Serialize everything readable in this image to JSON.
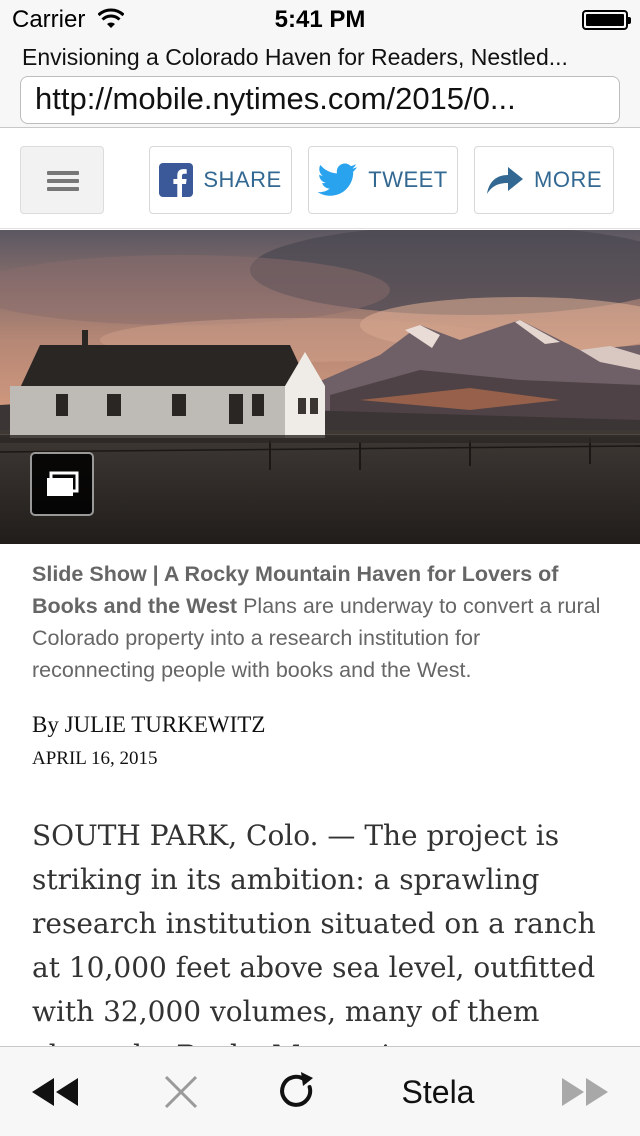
{
  "status_bar": {
    "carrier": "Carrier",
    "time": "5:41 PM"
  },
  "browser": {
    "page_title": "Envisioning a Colorado Haven for Readers, Nestled...",
    "url": "http://mobile.nytimes.com/2015/0..."
  },
  "share_toolbar": {
    "menu_icon": "hamburger-icon",
    "share_label": "SHARE",
    "tweet_label": "TWEET",
    "more_label": "MORE",
    "accent_color": "#326891"
  },
  "caption": {
    "title": "Slide Show | A Rocky Mountain Haven for Lovers of Books and the West",
    "text": "Plans are underway to convert a rural Colorado property into a research institution for reconnecting people with books and the West."
  },
  "article": {
    "byline": "By JULIE TURKEWITZ",
    "date": "APRIL 16, 2015",
    "body": "SOUTH PARK, Colo. — The project is striking in its ambition: a sprawling research institution situated on a ranch at 10,000 feet above sea level, outfitted with 32,000 volumes, many of them about the Rocky Mountains, pioneering..."
  },
  "bottom_toolbar": {
    "back_icon": "rewind-icon",
    "stop_icon": "close-icon",
    "reload_icon": "reload-icon",
    "app_label": "Stela",
    "forward_icon": "fast-forward-icon"
  }
}
